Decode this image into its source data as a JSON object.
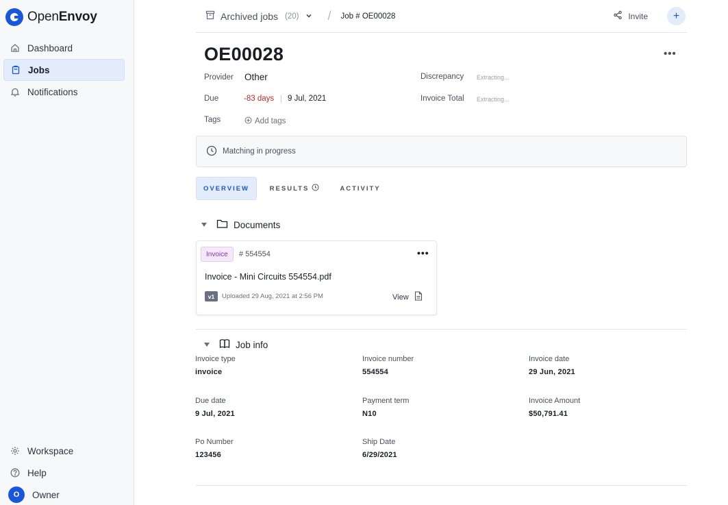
{
  "app": {
    "logo_text_light": "Open",
    "logo_text_bold": "Envoy"
  },
  "sidebar": {
    "items": [
      {
        "label": "Dashboard",
        "icon": "home-icon"
      },
      {
        "label": "Jobs",
        "icon": "clipboard-icon",
        "active": true
      },
      {
        "label": "Notifications",
        "icon": "bell-icon"
      }
    ],
    "bottom": [
      {
        "label": "Workspace",
        "icon": "gear-icon"
      },
      {
        "label": "Help",
        "icon": "help-icon"
      },
      {
        "label": "Owner",
        "avatar_initial": "O"
      }
    ]
  },
  "header": {
    "archive_label": "Archived jobs",
    "archive_count": "(20)",
    "separator": "/",
    "job_crumb": "Job # OE00028",
    "invite_label": "Invite",
    "add_symbol": "+"
  },
  "job": {
    "title": "OE00028",
    "provider_label": "Provider",
    "provider_value": "Other",
    "due_label": "Due",
    "due_relative": "-83 days",
    "due_date": "9 Jul, 2021",
    "tags_label": "Tags",
    "add_tags": "Add tags",
    "discrepancy_label": "Discrepancy",
    "discrepancy_value": "Extracting...",
    "invoice_total_label": "Invoice Total",
    "invoice_total_value": "Extracting...",
    "more": "•••"
  },
  "status": {
    "text": "Matching in progress"
  },
  "tabs": [
    {
      "label": "OVERVIEW",
      "active": true
    },
    {
      "label": "RESULTS"
    },
    {
      "label": "ACTIVITY"
    }
  ],
  "documents": {
    "title": "Documents",
    "card": {
      "badge": "Invoice",
      "number": "# 554554",
      "filename": "Invoice - Mini Circuits 554554.pdf",
      "version": "v1",
      "uploaded": "Uploaded 29 Aug, 2021 at 2:56 PM",
      "view": "View",
      "more": "•••"
    }
  },
  "job_info": {
    "title": "Job info",
    "fields": [
      {
        "label": "Invoice type",
        "value": "invoice"
      },
      {
        "label": "Invoice number",
        "value": "554554"
      },
      {
        "label": "Invoice date",
        "value": "29 Jun, 2021"
      },
      {
        "label": "Due date",
        "value": "9 Jul, 2021"
      },
      {
        "label": "Payment term",
        "value": "N10"
      },
      {
        "label": "Invoice Amount",
        "value": "$50,791.41"
      },
      {
        "label": "Po Number",
        "value": "123456"
      },
      {
        "label": "Ship Date",
        "value": "6/29/2021"
      }
    ]
  },
  "colors": {
    "accent": "#1a56db",
    "danger": "#c62828",
    "badge_bg": "#f5e8fb"
  }
}
